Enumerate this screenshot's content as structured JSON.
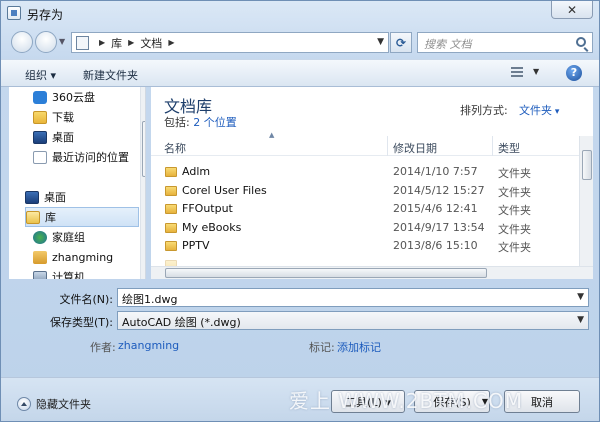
{
  "window": {
    "title": "另存为"
  },
  "address_bar": {
    "crumbs": [
      "库",
      "文档"
    ],
    "search_placeholder": "搜索 文档"
  },
  "toolbar": {
    "organize": "组织 ▾",
    "new_folder": "新建文件夹"
  },
  "sidebar": {
    "items": [
      {
        "label": "360云盘",
        "icon": "cloud-icon"
      },
      {
        "label": "下载",
        "icon": "folder-icon"
      },
      {
        "label": "桌面",
        "icon": "desktop-icon"
      },
      {
        "label": "最近访问的位置",
        "icon": "recent-places-icon"
      },
      {
        "label": "桌面",
        "icon": "desktop-icon"
      },
      {
        "label": "库",
        "icon": "library-icon",
        "selected": true
      },
      {
        "label": "家庭组",
        "icon": "homegroup-icon"
      },
      {
        "label": "zhangming",
        "icon": "user-folder-icon"
      },
      {
        "label": "计算机",
        "icon": "computer-icon"
      }
    ]
  },
  "library": {
    "title": "文档库",
    "includes_label": "包括:",
    "includes_link": "2 个位置",
    "arrange_label": "排列方式:",
    "arrange_value": "文件夹"
  },
  "file_list": {
    "columns": {
      "name": "名称",
      "date": "修改日期",
      "type": "类型"
    },
    "rows": [
      {
        "name": "Adlm",
        "date": "2014/1/10 7:57",
        "type": "文件夹"
      },
      {
        "name": "Corel User Files",
        "date": "2014/5/12 15:27",
        "type": "文件夹"
      },
      {
        "name": "FFOutput",
        "date": "2015/4/6 12:41",
        "type": "文件夹"
      },
      {
        "name": "My eBooks",
        "date": "2014/9/17 13:54",
        "type": "文件夹"
      },
      {
        "name": "PPTV",
        "date": "2013/8/6 15:10",
        "type": "文件夹"
      }
    ]
  },
  "form": {
    "filename_label": "文件名(N):",
    "filename_value": "绘图1.dwg",
    "filetype_label": "保存类型(T):",
    "filetype_value": "AutoCAD 绘图 (*.dwg)",
    "author_label": "作者:",
    "author_value": "zhangming",
    "tags_label": "标记:",
    "tags_value": "添加标记"
  },
  "footer": {
    "hide_folders": "隐藏文件夹",
    "tools_label": "工具(L) ▾",
    "save_label": "保存(S)",
    "cancel_label": "取消"
  },
  "watermark": "爱上 WWW.2BTM.COM"
}
